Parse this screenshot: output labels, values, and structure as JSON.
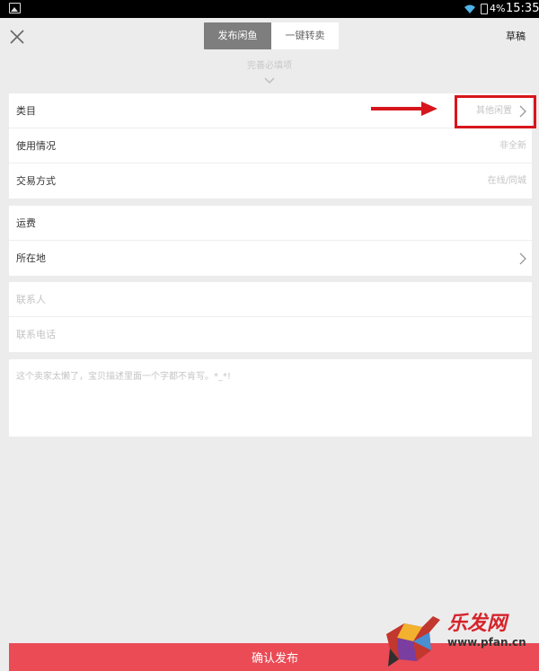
{
  "status_bar": {
    "battery": "4%",
    "time": "15:35"
  },
  "header": {
    "tabs": [
      {
        "label": "发布闲鱼",
        "active": true
      },
      {
        "label": "一键转卖",
        "active": false
      }
    ],
    "draft_label": "草稿"
  },
  "hint": "完善必填项",
  "section_basic": {
    "rows": [
      {
        "label": "类目",
        "value": "其他闲置",
        "has_arrow": true
      },
      {
        "label": "使用情况",
        "value": "非全新",
        "has_arrow": false
      },
      {
        "label": "交易方式",
        "value": "在线/同城",
        "has_arrow": false
      }
    ]
  },
  "section_shipping": {
    "rows": [
      {
        "label": "运费",
        "value": "",
        "has_arrow": false
      },
      {
        "label": "所在地",
        "value": "",
        "has_arrow": true
      }
    ]
  },
  "section_contact": {
    "contact_placeholder": "联系人",
    "phone_placeholder": "联系电话"
  },
  "description_placeholder": "这个卖家太懒了，宝贝描述里面一个字都不肯写。*_*!",
  "submit_label": "确认发布",
  "watermark": {
    "logo_text": "乐发网",
    "url": "www.pfan.cn"
  },
  "colors": {
    "accent": "#ea4b55",
    "highlight": "#d7161c",
    "active_tab": "#7e7e7e"
  }
}
